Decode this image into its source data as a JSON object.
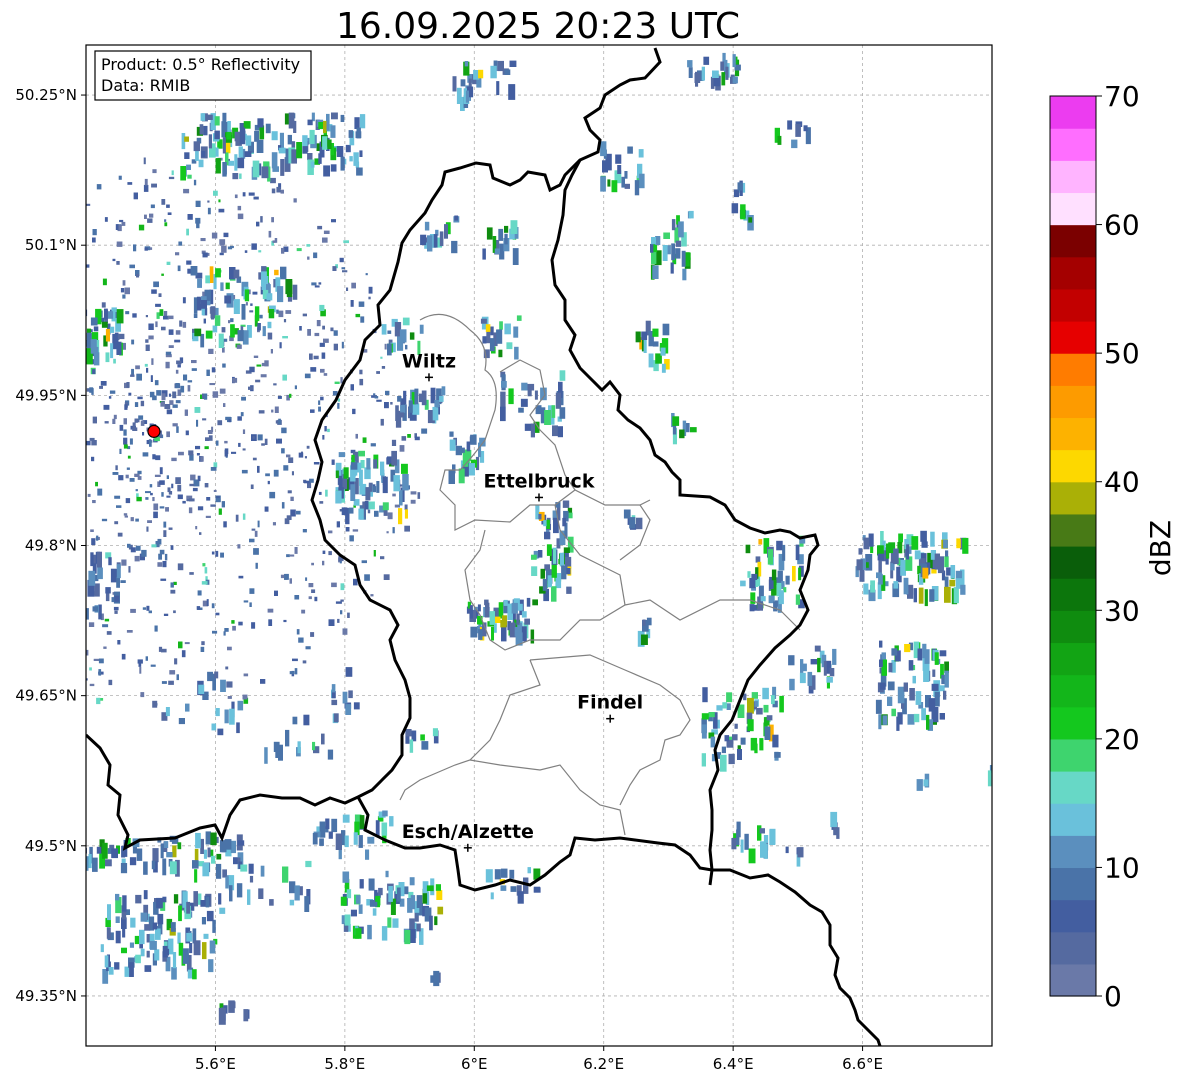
{
  "title": "16.09.2025 20:23 UTC",
  "info_box": {
    "product": "Product: 0.5° Reflectivity",
    "data_source": "Data: RMIB"
  },
  "axes": {
    "lon_ticks": [
      "5.6°E",
      "5.8°E",
      "6°E",
      "6.2°E",
      "6.4°E",
      "6.6°E"
    ],
    "lat_ticks": [
      "50.25°N",
      "50.1°N",
      "49.95°N",
      "49.8°N",
      "49.65°N",
      "49.5°N",
      "49.35°N"
    ],
    "lon_values": [
      5.6,
      5.8,
      6.0,
      6.2,
      6.4,
      6.6
    ],
    "lat_values": [
      50.25,
      50.1,
      49.95,
      49.8,
      49.65,
      49.5,
      49.35
    ],
    "lon_range": [
      5.4,
      6.8
    ],
    "lat_range": [
      49.3,
      50.3
    ],
    "grid": true
  },
  "cities": [
    {
      "name": "Wiltz",
      "lon": 5.93,
      "lat": 49.968
    },
    {
      "name": "Ettelbruck",
      "lon": 6.1,
      "lat": 49.848
    },
    {
      "name": "Findel",
      "lon": 6.21,
      "lat": 49.627
    },
    {
      "name": "Esch/Alzette",
      "lon": 5.99,
      "lat": 49.498
    }
  ],
  "radar_site": {
    "lon": 5.505,
    "lat": 49.914,
    "color": "#ff0000"
  },
  "colorbar": {
    "label": "dBZ",
    "min": 0,
    "max": 70,
    "ticks": [
      "0",
      "10",
      "20",
      "30",
      "40",
      "50",
      "60",
      "70"
    ],
    "colors": [
      "#6a79a8",
      "#556aa0",
      "#435ea0",
      "#4a73a8",
      "#5b8fbe",
      "#6ac1db",
      "#67d8c6",
      "#3ed46e",
      "#14c81e",
      "#13b61a",
      "#12a414",
      "#0f8c0f",
      "#0c760c",
      "#0a5e0a",
      "#487a16",
      "#aab006",
      "#fdd800",
      "#fdb200",
      "#fd9b00",
      "#ff7c00",
      "#e60000",
      "#c20000",
      "#a40000",
      "#7b0000",
      "#ffe0ff",
      "#ffb4ff",
      "#ff6eff",
      "#ec3cf0"
    ]
  }
}
